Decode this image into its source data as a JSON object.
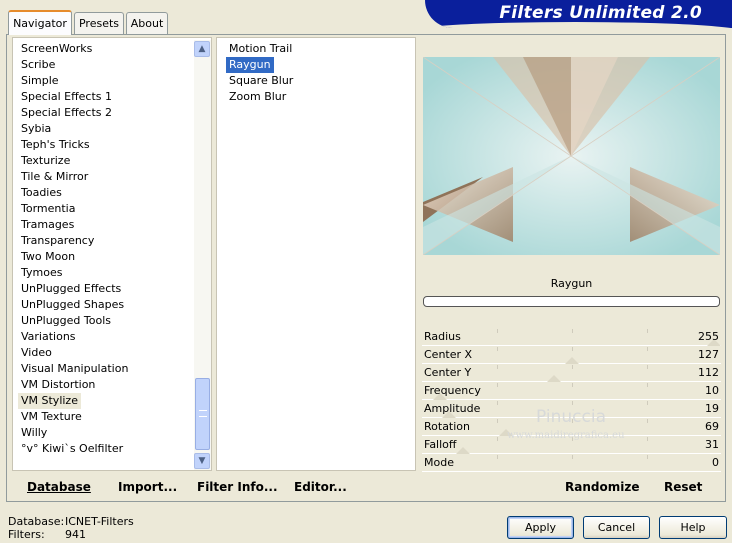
{
  "title": "Filters Unlimited 2.0",
  "tabs": [
    {
      "label": "Navigator",
      "active": true
    },
    {
      "label": "Presets",
      "active": false
    },
    {
      "label": "About",
      "active": false
    }
  ],
  "categories": [
    "ScreenWorks",
    "Scribe",
    "Simple",
    "Special Effects 1",
    "Special Effects 2",
    "Sybia",
    "Teph's Tricks",
    "Texturize",
    "Tile & Mirror",
    "Toadies",
    "Tormentia",
    "Tramages",
    "Transparency",
    "Two Moon",
    "Tymoes",
    "UnPlugged Effects",
    "UnPlugged Shapes",
    "UnPlugged Tools",
    "Variations",
    "Video",
    "Visual Manipulation",
    "VM Distortion",
    "VM Stylize",
    "VM Texture",
    "Willy",
    "°v° Kiwi`s Oelfilter"
  ],
  "selected_category": "VM Stylize",
  "filters": [
    "Motion Trail",
    "Raygun",
    "Square Blur",
    "Zoom Blur"
  ],
  "selected_filter": "Raygun",
  "preview_filter_name": "Raygun",
  "progress": 0,
  "params": [
    {
      "label": "Radius",
      "value": "255",
      "slider": 1.0
    },
    {
      "label": "Center X",
      "value": "127",
      "slider": 0.5
    },
    {
      "label": "Center Y",
      "value": "112",
      "slider": 0.44
    },
    {
      "label": "Frequency",
      "value": "10",
      "slider": 0.04
    },
    {
      "label": "Amplitude",
      "value": "19",
      "slider": 0.07
    },
    {
      "label": "Rotation",
      "value": "69",
      "slider": 0.27
    },
    {
      "label": "Falloff",
      "value": "31",
      "slider": 0.12
    },
    {
      "label": "Mode",
      "value": "0",
      "slider": 0.0
    }
  ],
  "toolbar": {
    "database": "Database",
    "import": "Import...",
    "filter_info": "Filter Info...",
    "editor": "Editor...",
    "randomize": "Randomize",
    "reset": "Reset"
  },
  "status": {
    "database_label": "Database:",
    "database_value": "ICNET-Filters",
    "filters_label": "Filters:",
    "filters_value": "941"
  },
  "buttons": {
    "apply": "Apply",
    "cancel": "Cancel",
    "help": "Help"
  },
  "watermark": {
    "name": "Pinuccia",
    "url": "www.maidiregrafica.eu"
  },
  "colors": {
    "selection": "#316ac5",
    "banner": "#0a1f9c",
    "tab_highlight": "#e68b2c"
  }
}
